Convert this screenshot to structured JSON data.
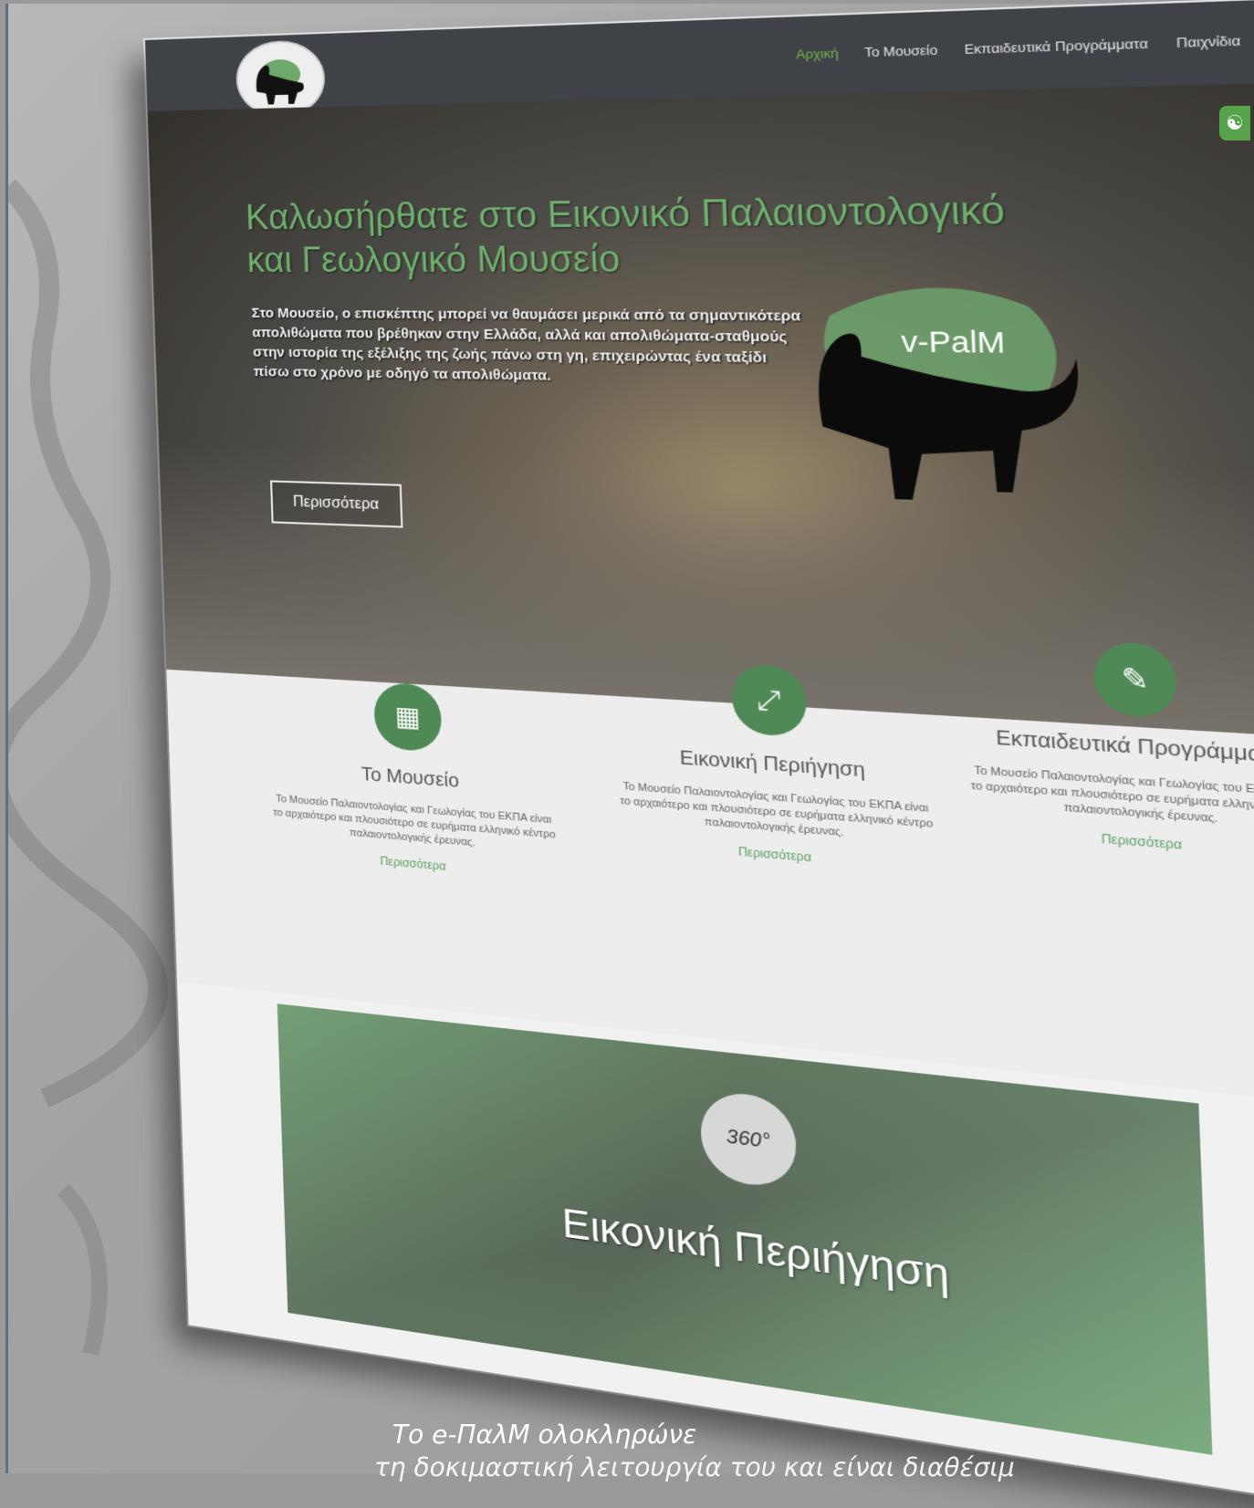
{
  "nav": {
    "items": [
      {
        "label": "Αρχική",
        "active": true
      },
      {
        "label": "Το Μουσείο",
        "active": false
      },
      {
        "label": "Εκπαιδευτικά Προγράμματα",
        "active": false
      },
      {
        "label": "Παιχνίδια",
        "active": false
      }
    ]
  },
  "hero": {
    "title": "Καλωσήρθατε στο Εικονικό Παλαιοντολογικό και Γεωλογικό Μουσείο",
    "text": "Στο Μουσείο, ο επισκέπτης μπορεί να θαυμάσει μερικά από τα σημαντικότερα απολιθώματα που βρέθηκαν στην Ελλάδα, αλλά και απολιθώματα-σταθμούς στην ιστορία της εξέλιξης της ζωής πάνω στη γη, επιχειρώντας ένα ταξίδι πίσω στο χρόνο με οδηγό τα απολιθώματα.",
    "button": "Περισσότερα",
    "logo_text": "v-PalM"
  },
  "features": [
    {
      "title": "Το Μουσείο",
      "desc": "Το Μουσείο Παλαιοντολογίας και Γεωλογίας του ΕΚΠΑ είναι το αρχαιότερο και πλουσιότερο σε ευρήματα ελληνικό κέντρο παλαιοντολογικής έρευνας.",
      "more": "Περισσότερα",
      "icon": "building-icon"
    },
    {
      "title": "Εικονική Περιήγηση",
      "desc": "Το Μουσείο Παλαιοντολογίας και Γεωλογίας του ΕΚΠΑ είναι το αρχαιότερο και πλουσιότερο σε ευρήματα ελληνικό κέντρο παλαιοντολογικής έρευνας.",
      "more": "Περισσότερα",
      "icon": "expand-icon"
    },
    {
      "title": "Εκπαιδευτικά Προγράμματα",
      "desc": "Το Μουσείο Παλαιοντολογίας και Γεωλογίας του ΕΚΠΑ είναι το αρχαιότερο και πλουσιότερο σε ευρήματα ελληνικό κέντρο παλαιοντολογικής έρευνας.",
      "more": "Περισσότερα",
      "icon": "edit-icon"
    }
  ],
  "tour": {
    "badge": "360°",
    "title": "Εικονική Περιήγηση"
  },
  "caption": {
    "line1": "Το e-ΠαλΜ ολοκληρώνε",
    "line2": "τη δοκιμαστική λειτουργία του και είναι διαθέσιμ"
  },
  "colors": {
    "accent": "#4f8a56",
    "nav_bg": "#3f4347",
    "active_nav": "#7ab24f"
  }
}
